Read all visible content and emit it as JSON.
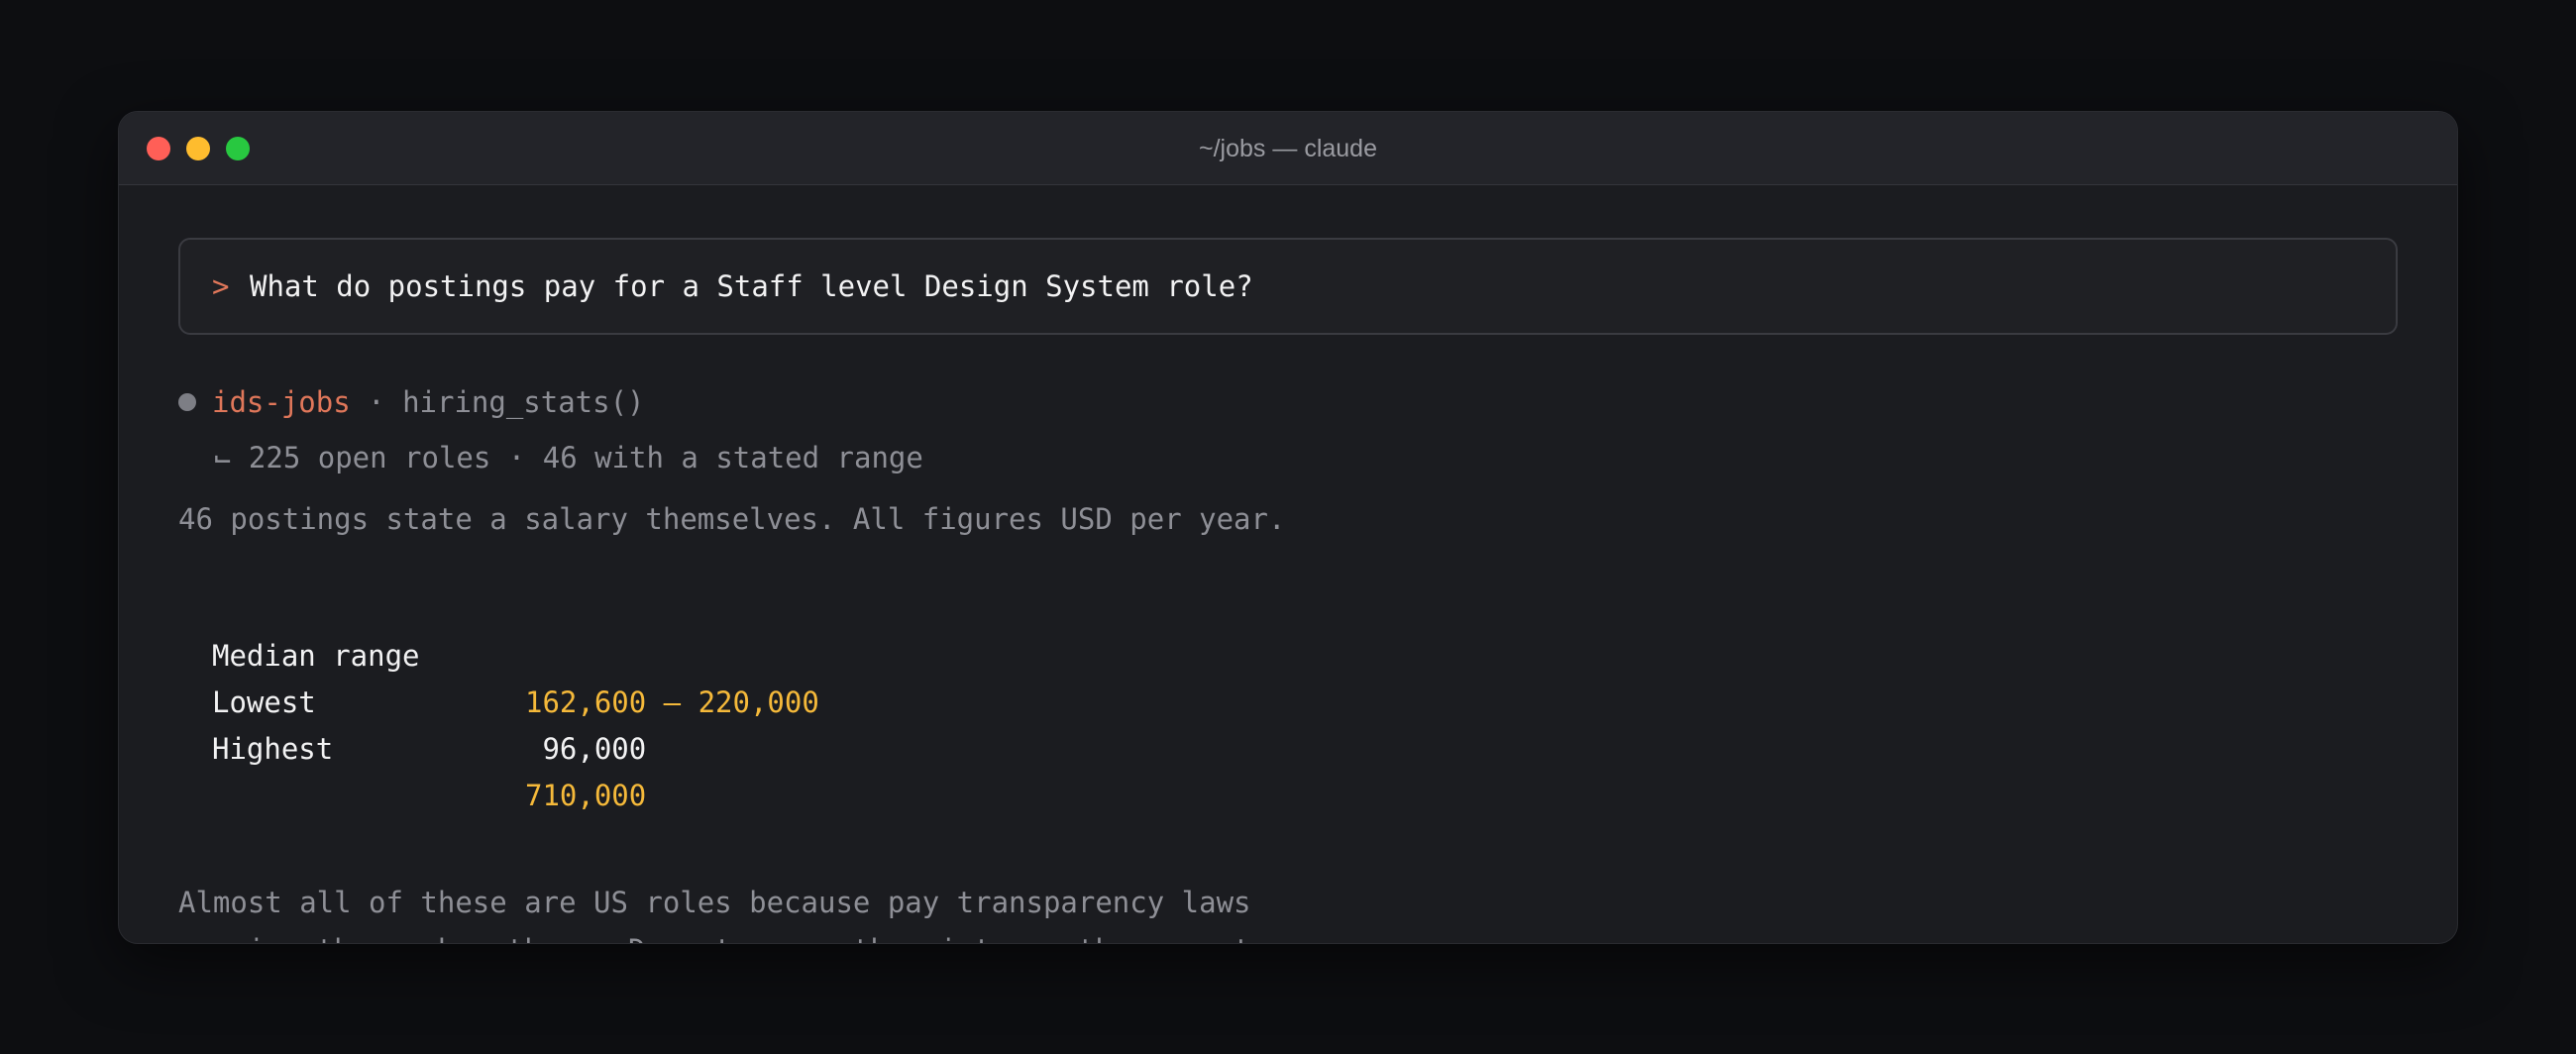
{
  "window": {
    "title": "~/jobs — claude"
  },
  "prompt": {
    "caret": ">",
    "text": "What do postings pay for a Staff level Design System role?"
  },
  "tool_call": {
    "name": "ids-jobs",
    "separator": " · ",
    "function": "hiring_stats()",
    "result": "⌙ 225 open roles · 46 with a stated range"
  },
  "summary": "46 postings state a salary themselves. All figures USD per year.",
  "stats": [
    {
      "label": "Median range",
      "value": "162,600 – 220,000",
      "style": "accent"
    },
    {
      "label": "Lowest",
      "value": " 96,000",
      "style": "plain"
    },
    {
      "label": "Highest",
      "value": "710,000",
      "style": "accent"
    }
  ],
  "note": {
    "line1": "Almost all of these are US roles because pay transparency laws",
    "line2": "require the number there. Do not carry them into another country."
  },
  "colors": {
    "accent_orange": "#e0775a",
    "accent_yellow": "#f5b93a",
    "traffic_red": "#ff5f57",
    "traffic_yellow": "#febc2e",
    "traffic_green": "#28c840"
  }
}
